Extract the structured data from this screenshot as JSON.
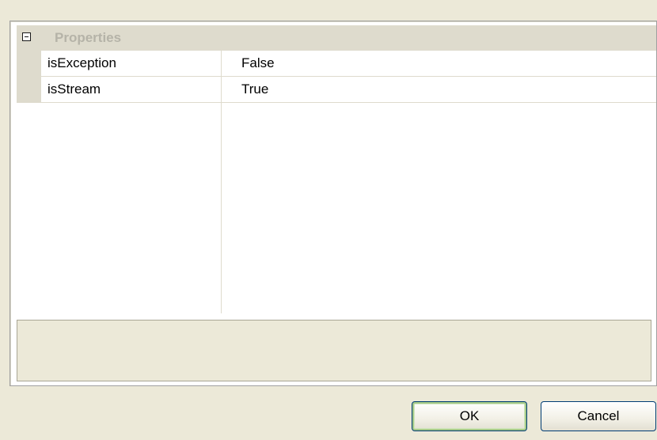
{
  "grid": {
    "category": {
      "label": "Properties",
      "expanded": true
    },
    "properties": [
      {
        "name": "isException",
        "value": "False"
      },
      {
        "name": "isStream",
        "value": "True"
      }
    ]
  },
  "buttons": {
    "ok_label": "OK",
    "cancel_label": "Cancel"
  },
  "icons": {
    "expander": "collapse-minus-icon"
  }
}
